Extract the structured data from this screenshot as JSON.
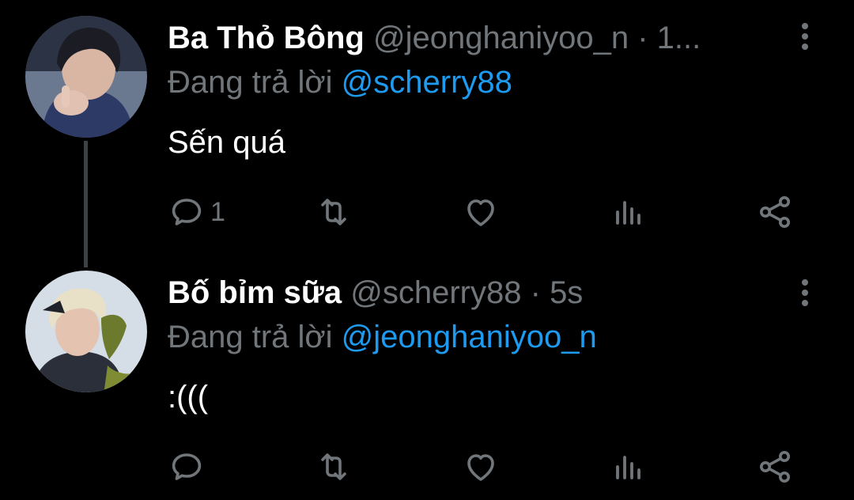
{
  "colors": {
    "background": "#000000",
    "text_primary": "#ffffff",
    "text_secondary": "#71767b",
    "link": "#1d9bf0",
    "thread_line": "#3e4144"
  },
  "tweets": [
    {
      "display_name": "Ba Thỏ Bông",
      "handle": "@jeonghaniyoo_n",
      "separator": "·",
      "time": "1...",
      "reply_prefix": "Đang trả lời",
      "reply_to": "@scherry88",
      "text": "Sến quá",
      "actions": {
        "reply_count": "1",
        "retweet_count": "",
        "like_count": ""
      },
      "icons": [
        "speech-bubble-icon",
        "retweet-icon",
        "heart-icon",
        "bar-chart-icon",
        "share-icon",
        "more-vertical-icon"
      ]
    },
    {
      "display_name": "Bố bỉm sữa",
      "handle": "@scherry88",
      "separator": "·",
      "time": "5s",
      "reply_prefix": "Đang trả lời",
      "reply_to": "@jeonghaniyoo_n",
      "text": ":(((",
      "actions": {
        "reply_count": "",
        "retweet_count": "",
        "like_count": ""
      },
      "icons": [
        "speech-bubble-icon",
        "retweet-icon",
        "heart-icon",
        "bar-chart-icon",
        "share-icon",
        "more-vertical-icon"
      ]
    }
  ]
}
